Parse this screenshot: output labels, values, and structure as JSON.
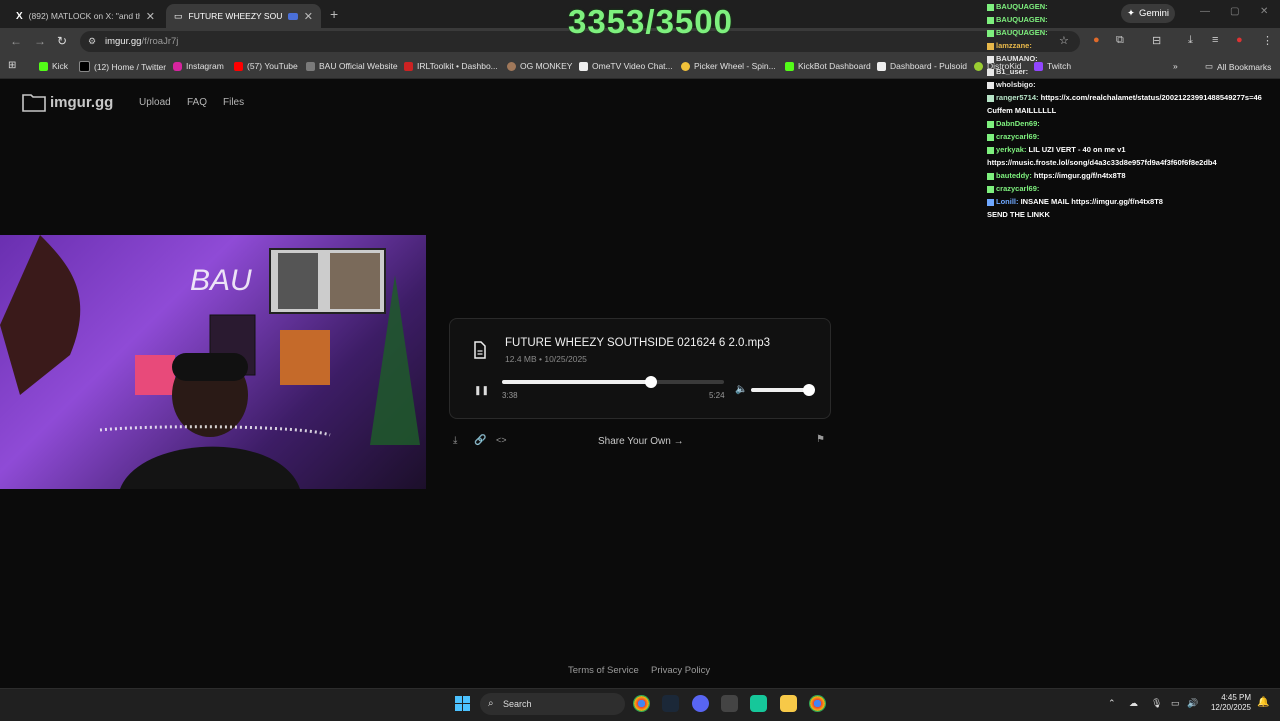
{
  "browser": {
    "tabs": [
      {
        "title": "(892) MATLOCK on X: \"and that",
        "active": false
      },
      {
        "title": "FUTURE WHEEZY SOUTHSIDE",
        "active": true
      }
    ],
    "gemini_label": "Gemini",
    "url_host": "imgur.gg",
    "url_path": "/f/roaJr7j",
    "bookmarks": [
      "Kick",
      "(12) Home / Twitter",
      "Instagram",
      "(57) YouTube",
      "BAU Official Website",
      "IRLToolkit • Dashbo...",
      "OG MONKEY",
      "OmeTV Video Chat...",
      "Picker Wheel - Spin...",
      "KickBot Dashboard",
      "Dashboard - Pulsoid",
      "DistroKid",
      "Twitch"
    ],
    "all_bookmarks_label": "All Bookmarks"
  },
  "site": {
    "logo_text": "imgur.gg",
    "nav": [
      "Upload",
      "FAQ",
      "Files"
    ],
    "file": {
      "name": "FUTURE WHEEZY SOUTHSIDE 021624 6 2.0.mp3",
      "meta": "12.4 MB • 10/25/2025",
      "current_time": "3:38",
      "duration": "5:24",
      "progress": 0.67,
      "volume": 1.0
    },
    "share_label": "Share Your Own →",
    "footer": [
      "Terms of Service",
      "Privacy Policy"
    ]
  },
  "overlay": {
    "counter": "3353/3500",
    "chat": [
      {
        "user": "BAUQUAGEN:",
        "msg": "",
        "color": "#7ef07e"
      },
      {
        "user": "BAUQUAGEN:",
        "msg": "",
        "color": "#7ef07e"
      },
      {
        "user": "BAUQUAGEN:",
        "msg": "",
        "color": "#7ef07e"
      },
      {
        "user": "lamzzane:",
        "msg": "",
        "color": "#e8b84a"
      },
      {
        "user": "BAUMANO:",
        "msg": "",
        "color": "#e8e8e8"
      },
      {
        "user": "B1_user:",
        "msg": "",
        "color": "#e8e8e8"
      },
      {
        "user": "wholsbigo:",
        "msg": "",
        "color": "#e8e8e8"
      },
      {
        "user": "ranger5714:",
        "msg": "https://x.com/realchalamet/status/20021223991488549277s=46",
        "color": "#b7e4c7"
      },
      {
        "user": "",
        "msg": "Cuffem MAILLLLLL",
        "color": "#fff"
      },
      {
        "user": "DabnDen69:",
        "msg": "",
        "color": "#7ef07e"
      },
      {
        "user": "crazycarl69:",
        "msg": "",
        "color": "#7ef07e"
      },
      {
        "user": "yerkyak:",
        "msg": "LIL UZI VERT - 40 on me v1",
        "color": "#7ef07e"
      },
      {
        "user": "",
        "msg": "https://music.froste.lol/song/d4a3c33d8e957fd9a4f3f60f6f8e2db4",
        "color": "#fff"
      },
      {
        "user": "bauteddy:",
        "msg": "https://imgur.gg/f/n4tx8T8",
        "color": "#7ef07e"
      },
      {
        "user": "crazycarl69:",
        "msg": "",
        "color": "#7ef07e"
      },
      {
        "user": "Lonill:",
        "msg": "INSANE MAIL https://imgur.gg/f/n4tx8T8",
        "color": "#6fa8ff"
      },
      {
        "user": "",
        "msg": "SEND THE LINKK",
        "color": "#fff"
      }
    ]
  },
  "taskbar": {
    "search_label": "Search",
    "time": "4:45 PM",
    "date": "12/20/2025"
  },
  "colors": {
    "accent": "#7ef07e",
    "page_bg": "#0b0b0b"
  }
}
